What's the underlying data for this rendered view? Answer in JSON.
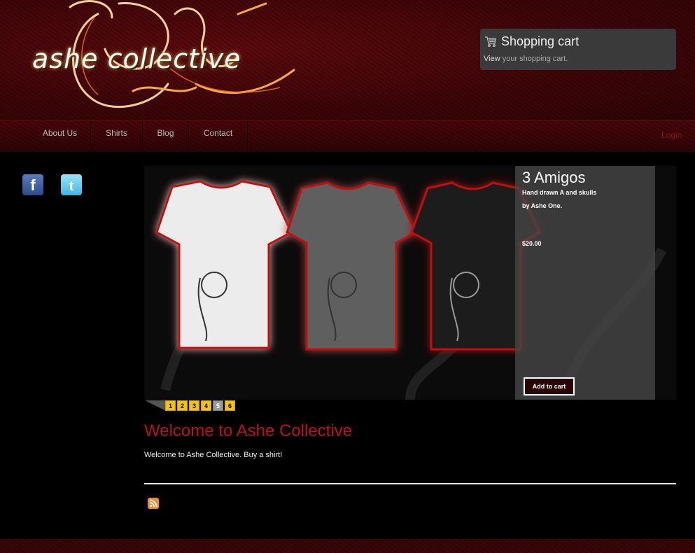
{
  "header": {
    "logo_text": "ashe collective",
    "cart": {
      "title": "Shopping cart",
      "link_view": "View",
      "link_rest": " your shopping cart.",
      "icon": "cart-icon"
    }
  },
  "nav": {
    "items": [
      "About Us",
      "Shirts",
      "Blog",
      "Contact"
    ],
    "login": "Login"
  },
  "social": {
    "facebook_glyph": "f",
    "twitter_glyph": "t"
  },
  "slider": {
    "product_title": "3 Amigos",
    "desc_line1": "Hand drawn A and skulls",
    "desc_line2": "by Ashe One.",
    "price": "$20.00",
    "add_to_cart": "Add to cart",
    "pages": [
      "1",
      "2",
      "3",
      "4",
      "5",
      "6"
    ],
    "active_page": "5"
  },
  "content": {
    "welcome_title": "Welcome to Ashe Collective",
    "welcome_text": "Welcome to Ashe Collective.  Buy a shirt!"
  },
  "colors": {
    "brand_red": "#b81414",
    "pager_yellow": "#f2c20f"
  }
}
